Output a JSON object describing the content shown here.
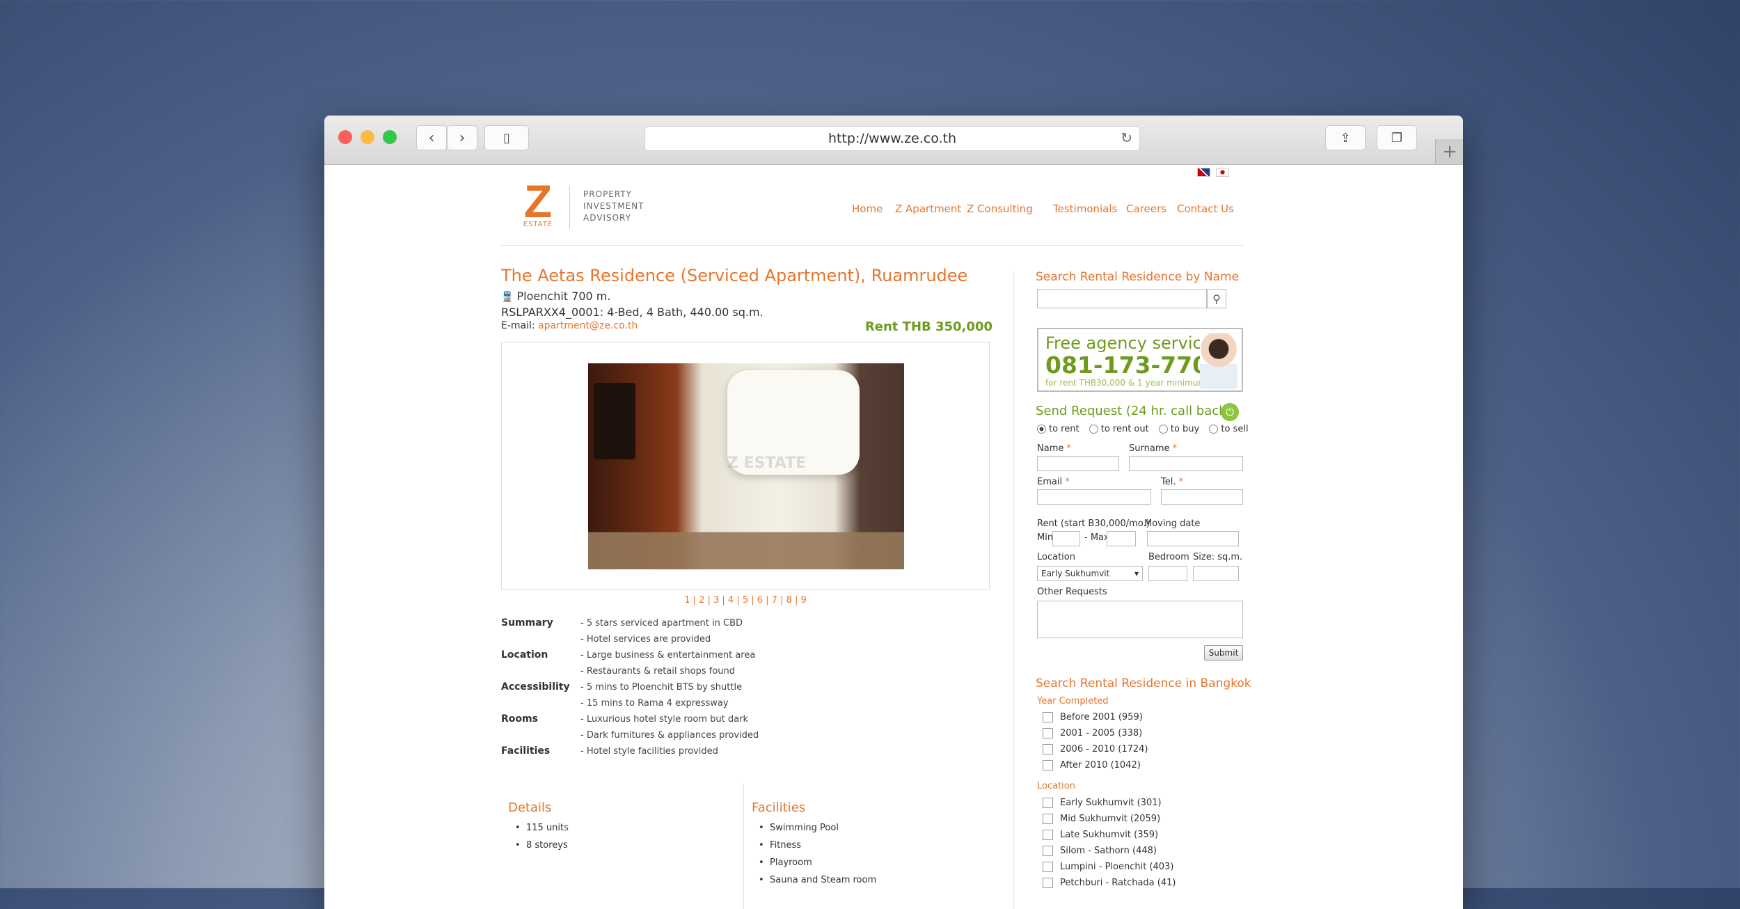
{
  "browser": {
    "url": "http://www.ze.co.th"
  },
  "logo": {
    "letter": "Z",
    "sub": "ESTATE",
    "tagline": [
      "PROPERTY",
      "INVESTMENT",
      "ADVISORY"
    ]
  },
  "nav": [
    "Home",
    "Z Apartment",
    "Z Consulting",
    "Testimonials",
    "Careers",
    "Contact Us"
  ],
  "listing": {
    "title": "The Aetas Residence (Serviced Apartment), Ruamrudee",
    "station": "Ploenchit 700 m.",
    "code_line": "RSLPARXX4_0001: 4-Bed, 4 Bath, 440.00 sq.m.",
    "email_label": "E-mail:",
    "email": "apartment@ze.co.th",
    "rent": "Rent THB 350,000",
    "watermark": "Z ESTATE",
    "pages": "1 | 2 | 3 | 4 | 5 | 6 | 7 | 8 | 9",
    "info": [
      {
        "key": "Summary",
        "values": [
          "- 5 stars serviced apartment in CBD",
          "- Hotel services are provided"
        ]
      },
      {
        "key": "Location",
        "values": [
          "- Large business & entertainment area",
          "- Restaurants & retail shops found"
        ]
      },
      {
        "key": "Accessibility",
        "values": [
          "- 5 mins to Ploenchit BTS by shuttle",
          "- 15 mins to Rama 4 expressway"
        ]
      },
      {
        "key": "Rooms",
        "values": [
          "- Luxurious hotel style room but dark",
          "- Dark furnitures & appliances provided"
        ]
      },
      {
        "key": "Facilities",
        "values": [
          "- Hotel style facilities provided"
        ]
      }
    ],
    "details": {
      "title": "Details",
      "items": [
        "115 units",
        "8 storeys"
      ]
    },
    "facilities": {
      "title": "Facilities",
      "items": [
        "Swimming Pool",
        "Fitness",
        "Playroom",
        "Sauna and Steam room"
      ]
    }
  },
  "sidebar": {
    "search_title": "Search Rental Residence by Name",
    "banner": {
      "line1": "Free agency service",
      "phone": "081-173-7700",
      "note": "for rent THB30,000 & 1 year minimum"
    },
    "request_title": "Send Request (24 hr. call back)",
    "radios": [
      "to rent",
      "to rent out",
      "to buy",
      "to sell"
    ],
    "fields": {
      "name": "Name",
      "surname": "Surname",
      "email": "Email",
      "tel": "Tel.",
      "required": "*",
      "rent": "Rent (start B30,000/mo.)",
      "min": "Min",
      "max": "- Max",
      "moving": "Moving date",
      "location": "Location",
      "location_value": "Early Sukhumvit",
      "bedroom": "Bedroom",
      "size": "Size: sq.m.",
      "other": "Other Requests",
      "submit": "Submit"
    },
    "bangkok_title": "Search Rental Residence in Bangkok",
    "year_label": "Year Completed",
    "years": [
      "Before 2001 (959)",
      "2001 - 2005 (338)",
      "2006 - 2010 (1724)",
      "After 2010 (1042)"
    ],
    "location_label": "Location",
    "locations": [
      "Early Sukhumvit (301)",
      "Mid Sukhumvit (2059)",
      "Late Sukhumvit (359)",
      "Silom - Sathorn (448)",
      "Lumpini - Ploenchit (403)",
      "Petchburi - Ratchada (41)"
    ]
  },
  "colors": {
    "accent": "#e5762c",
    "green": "#6e9b1e"
  }
}
